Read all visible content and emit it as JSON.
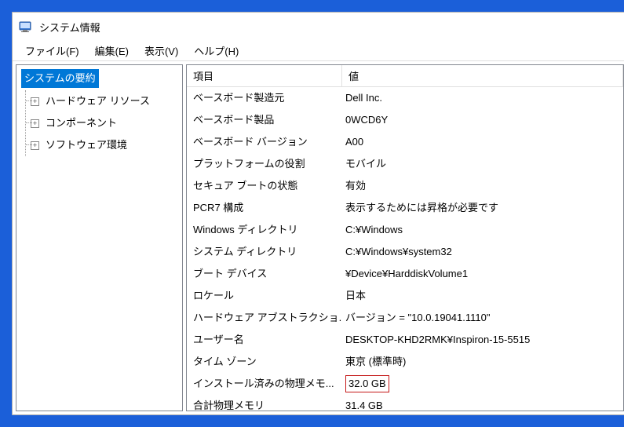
{
  "window": {
    "title": "システム情報"
  },
  "menu": {
    "file": "ファイル(F)",
    "edit": "編集(E)",
    "view": "表示(V)",
    "help": "ヘルプ(H)"
  },
  "tree": {
    "root": "システムの要約",
    "children": [
      "ハードウェア リソース",
      "コンポーネント",
      "ソフトウェア環境"
    ]
  },
  "table": {
    "headers": {
      "key": "項目",
      "value": "値"
    },
    "rows": [
      {
        "key": "ベースボード製造元",
        "value": "Dell Inc."
      },
      {
        "key": "ベースボード製品",
        "value": "0WCD6Y"
      },
      {
        "key": "ベースボード バージョン",
        "value": "A00"
      },
      {
        "key": "プラットフォームの役割",
        "value": "モバイル"
      },
      {
        "key": "セキュア ブートの状態",
        "value": "有効"
      },
      {
        "key": "PCR7 構成",
        "value": "表示するためには昇格が必要です"
      },
      {
        "key": "Windows ディレクトリ",
        "value": "C:¥Windows"
      },
      {
        "key": "システム ディレクトリ",
        "value": "C:¥Windows¥system32"
      },
      {
        "key": "ブート デバイス",
        "value": "¥Device¥HarddiskVolume1"
      },
      {
        "key": "ロケール",
        "value": "日本"
      },
      {
        "key": "ハードウェア アブストラクショ...",
        "value": "バージョン = \"10.0.19041.1110\""
      },
      {
        "key": "ユーザー名",
        "value": "DESKTOP-KHD2RMK¥Inspiron-15-5515"
      },
      {
        "key": "タイム ゾーン",
        "value": "東京 (標準時)"
      },
      {
        "key": "インストール済みの物理メモ...",
        "value": "32.0 GB",
        "highlight": true
      },
      {
        "key": "合計物理メモリ",
        "value": "31.4 GB"
      }
    ]
  }
}
